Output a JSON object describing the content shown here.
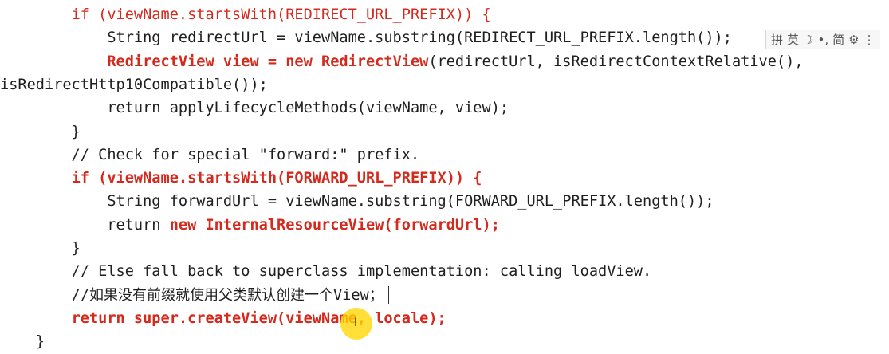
{
  "code_lines": [
    {
      "parts": [
        {
          "text": "        ",
          "style": ""
        },
        {
          "text": "if (viewName.startsWith(REDIRECT_URL_PREFIX)) {",
          "style": "red"
        }
      ]
    },
    {
      "parts": [
        {
          "text": "            String redirectUrl = viewName.substring(REDIRECT_URL_PREFIX.length());",
          "style": ""
        }
      ]
    },
    {
      "parts": [
        {
          "text": "            ",
          "style": ""
        },
        {
          "text": "RedirectView view = new RedirectView",
          "style": "red bold"
        },
        {
          "text": "(redirectUrl, isRedirectContextRelative(),",
          "style": ""
        }
      ]
    },
    {
      "parts": [
        {
          "text": "isRedirectHttp10Compatible());",
          "style": ""
        }
      ]
    },
    {
      "parts": [
        {
          "text": "            return applyLifecycleMethods(viewName, view);",
          "style": ""
        }
      ]
    },
    {
      "parts": [
        {
          "text": "        }",
          "style": ""
        }
      ]
    },
    {
      "parts": [
        {
          "text": "        // Check for special \"forward:\" prefix.",
          "style": ""
        }
      ]
    },
    {
      "parts": [
        {
          "text": "        ",
          "style": ""
        },
        {
          "text": "if (viewName.startsWith(FORWARD_URL_PREFIX)) {",
          "style": "red bold"
        }
      ]
    },
    {
      "parts": [
        {
          "text": "            String forwardUrl = viewName.substring(FORWARD_URL_PREFIX.length());",
          "style": ""
        }
      ]
    },
    {
      "parts": [
        {
          "text": "            return ",
          "style": ""
        },
        {
          "text": "new InternalResourceView(forwardUrl);",
          "style": "red bold"
        }
      ]
    },
    {
      "parts": [
        {
          "text": "        }",
          "style": ""
        }
      ]
    },
    {
      "parts": [
        {
          "text": "        // Else fall back to superclass implementation: calling loadView.",
          "style": ""
        }
      ]
    },
    {
      "parts": [
        {
          "text": "        //",
          "style": ""
        },
        {
          "text": "如果没有前缀就使用父类默认创建一个",
          "style": "cn"
        },
        {
          "text": "View",
          "style": ""
        },
        {
          "text": "；",
          "style": "cn"
        }
      ]
    },
    {
      "parts": [
        {
          "text": "        ",
          "style": ""
        },
        {
          "text": "return super.createView(viewName, locale);",
          "style": "red bold"
        }
      ]
    },
    {
      "parts": [
        {
          "text": "    }",
          "style": ""
        }
      ]
    }
  ],
  "ime_toolbar": {
    "items": [
      {
        "name": "ime-grid-icon",
        "text": "拼"
      },
      {
        "name": "ime-lang-toggle",
        "text": "英"
      },
      {
        "name": "ime-moon-icon",
        "text": "☽"
      },
      {
        "name": "ime-punct-toggle",
        "text": "•,"
      },
      {
        "name": "ime-simplified-toggle",
        "text": "简"
      },
      {
        "name": "ime-gear-icon",
        "text": "⚙"
      },
      {
        "name": "ime-more-icon",
        "text": "⋮"
      }
    ]
  }
}
